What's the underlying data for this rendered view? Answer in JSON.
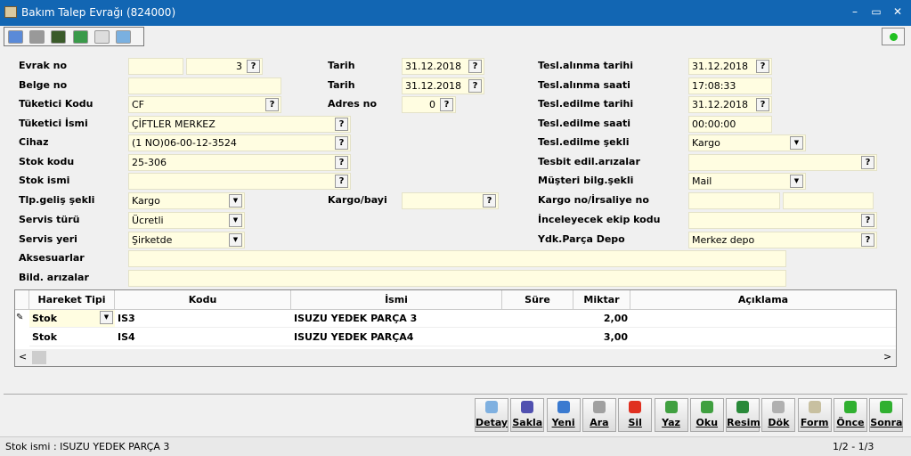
{
  "window": {
    "title": "Bakım Talep Evrağı (824000)",
    "min": "–",
    "max": "▭",
    "close": "✕"
  },
  "form": {
    "evrak_no": {
      "label": "Evrak no",
      "value1": "",
      "value2": "3"
    },
    "belge_no": {
      "label": "Belge no",
      "value": ""
    },
    "tuketici_kodu": {
      "label": "Tüketici Kodu",
      "value": "CF"
    },
    "tuketici_ismi": {
      "label": "Tüketici İsmi",
      "value": "ÇİFTLER MERKEZ"
    },
    "cihaz": {
      "label": "Cihaz",
      "value": "(1 NO)06-00-12-3524"
    },
    "stok_kodu": {
      "label": "Stok kodu",
      "value": "25-306"
    },
    "stok_ismi": {
      "label": "Stok ismi",
      "value": ""
    },
    "tlp_gelis": {
      "label": "Tlp.geliş şekli",
      "value": "Kargo"
    },
    "servis_turu": {
      "label": "Servis türü",
      "value": "Ücretli"
    },
    "servis_yeri": {
      "label": "Servis yeri",
      "value": "Şirketde"
    },
    "aksesuarlar": {
      "label": "Aksesuarlar",
      "value": ""
    },
    "bild_arizalar": {
      "label": "Bild. arızalar",
      "value": ""
    },
    "tarih1": {
      "label": "Tarih",
      "value": "31.12.2018"
    },
    "tarih2": {
      "label": "Tarih",
      "value": "31.12.2018"
    },
    "adres_no": {
      "label": "Adres no",
      "value": "0"
    },
    "kargo_bayi": {
      "label": "Kargo/bayi",
      "value": ""
    },
    "tesl_alinma_tarihi": {
      "label": "Tesl.alınma tarihi",
      "value": "31.12.2018"
    },
    "tesl_alinma_saati": {
      "label": "Tesl.alınma saati",
      "value": "17:08:33"
    },
    "tesl_edilme_tarihi": {
      "label": "Tesl.edilme tarihi",
      "value": "31.12.2018"
    },
    "tesl_edilme_saati": {
      "label": "Tesl.edilme saati",
      "value": "00:00:00"
    },
    "tesl_edilme_sekli": {
      "label": "Tesl.edilme şekli",
      "value": "Kargo"
    },
    "tesbit_arizalar": {
      "label": "Tesbit edil.arızalar",
      "value": ""
    },
    "musteri_bilg": {
      "label": "Müşteri bilg.şekli",
      "value": "Mail"
    },
    "kargo_no": {
      "label": "Kargo no/İrsaliye no",
      "value1": "",
      "value2": ""
    },
    "inceleyecek": {
      "label": "İnceleyecek ekip kodu",
      "value": ""
    },
    "ydk_depo": {
      "label": "Ydk.Parça Depo",
      "value": "Merkez depo"
    },
    "lookup": "?",
    "dropdown": "▼"
  },
  "grid": {
    "columns": [
      "Hareket Tipi",
      "Kodu",
      "İsmi",
      "Süre",
      "Miktar",
      "Açıklama"
    ],
    "rows": [
      {
        "tip": "Stok",
        "kodu": "IS3",
        "ismi": "ISUZU YEDEK PARÇA 3",
        "sure": "",
        "miktar": "2,00",
        "aciklama": ""
      },
      {
        "tip": "Stok",
        "kodu": "IS4",
        "ismi": "ISUZU YEDEK PARÇA4",
        "sure": "",
        "miktar": "3,00",
        "aciklama": ""
      }
    ],
    "scroll_left": "<",
    "scroll_right": ">"
  },
  "buttons": [
    {
      "label": "Detay",
      "color": "#7fb0e0"
    },
    {
      "label": "Sakla",
      "color": "#5050b0"
    },
    {
      "label": "Yeni",
      "color": "#3a7ad0"
    },
    {
      "label": "Ara",
      "color": "#a0a0a0"
    },
    {
      "label": "Sil",
      "color": "#e03020"
    },
    {
      "label": "Yaz",
      "color": "#40a040"
    },
    {
      "label": "Oku",
      "color": "#40a040"
    },
    {
      "label": "Resim",
      "color": "#2a8a3a"
    },
    {
      "label": "Dök",
      "color": "#b0b0b0"
    },
    {
      "label": "Form",
      "color": "#c8c0a0"
    },
    {
      "label": "Önce",
      "color": "#30b030"
    },
    {
      "label": "Sonra",
      "color": "#30b030"
    }
  ],
  "status": {
    "left": "Stok ismi : ISUZU YEDEK PARÇA 3",
    "right": "1/2 - 1/3"
  }
}
